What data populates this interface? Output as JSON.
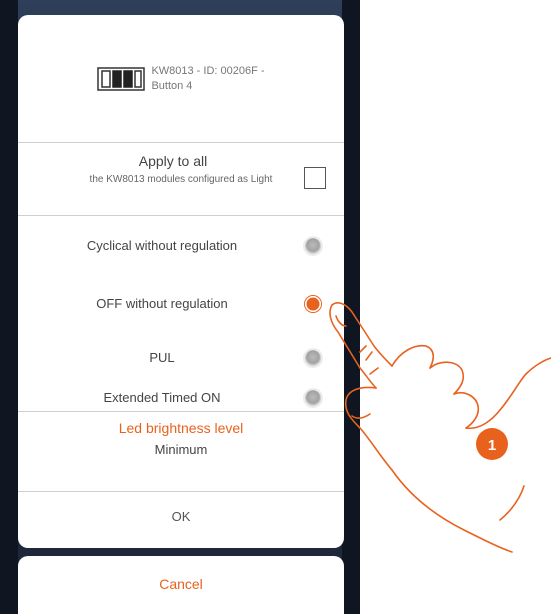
{
  "device": {
    "line1": "KW8013 - ID: 00206F -",
    "line2": "Button 4",
    "icon": "keypad-module-icon"
  },
  "apply": {
    "title": "Apply to all",
    "subtitle": "the KW8013 modules configured as Light",
    "checked": false
  },
  "options": [
    {
      "label": "Cyclical without regulation",
      "selected": false
    },
    {
      "label": "OFF without regulation",
      "selected": true
    },
    {
      "label": "PUL",
      "selected": false
    },
    {
      "label": "Extended Timed ON",
      "selected": false
    }
  ],
  "led": {
    "title": "Led brightness level",
    "value": "Minimum"
  },
  "buttons": {
    "ok": "OK",
    "cancel": "Cancel"
  },
  "callout": {
    "number": "1"
  },
  "colors": {
    "accent": "#e8621e",
    "background": "#223049"
  }
}
